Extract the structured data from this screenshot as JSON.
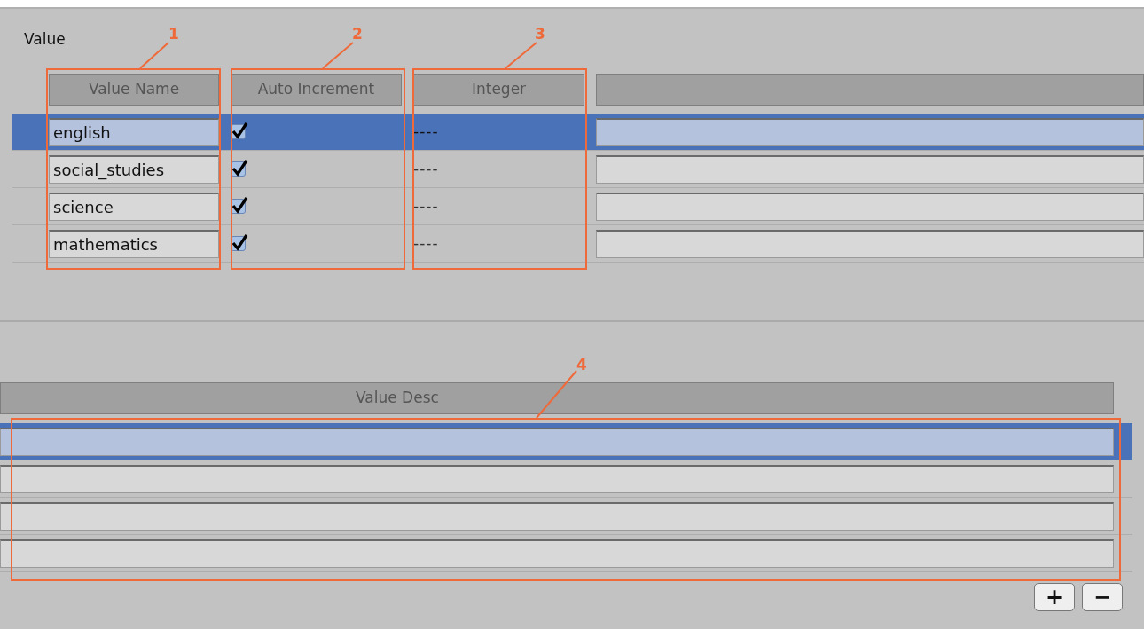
{
  "panel_title": "Value",
  "columns": [
    "Value Name",
    "Auto Increment",
    "Integer"
  ],
  "rows": [
    {
      "value_name": "english",
      "auto_increment": true,
      "integer": "----",
      "selected": true
    },
    {
      "value_name": "social_studies",
      "auto_increment": true,
      "integer": "----",
      "selected": false
    },
    {
      "value_name": "science",
      "auto_increment": true,
      "integer": "----",
      "selected": false
    },
    {
      "value_name": "mathematics",
      "auto_increment": true,
      "integer": "----",
      "selected": false
    }
  ],
  "desc_table": {
    "column": "Value Desc",
    "rows": [
      {
        "selected": true
      },
      {
        "selected": false
      },
      {
        "selected": false
      },
      {
        "selected": false
      }
    ]
  },
  "buttons": [
    "+",
    "−"
  ],
  "annotations": [
    {
      "label": "1"
    },
    {
      "label": "2"
    },
    {
      "label": "3"
    },
    {
      "label": "4"
    }
  ]
}
